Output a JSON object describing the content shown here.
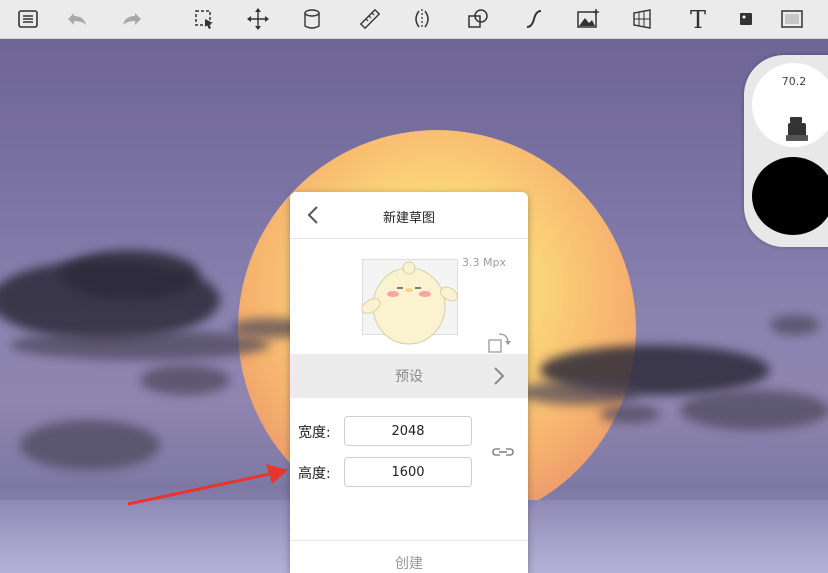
{
  "toolbar": {
    "icons": [
      "list-icon",
      "undo-icon",
      "redo-icon",
      "selection-icon",
      "transform-icon",
      "fill-icon",
      "ruler-icon",
      "symmetry-icon",
      "shapes-icon",
      "curve-icon",
      "image-icon",
      "perspective-icon",
      "text-icon",
      "layer-icon",
      "canvas-icon"
    ]
  },
  "brush": {
    "size": "70.2",
    "color": "#000000"
  },
  "dialog": {
    "title": "新建草图",
    "megapixels": "3.3 Mpx",
    "preset_label": "预设",
    "width_label": "宽度:",
    "width_value": "2048",
    "height_label": "高度:",
    "height_value": "1600",
    "create_label": "创建"
  },
  "colors": {
    "arrow": "#e8352e",
    "toolbar_bg": "#ebebeb",
    "preset_bg": "#ececec"
  }
}
